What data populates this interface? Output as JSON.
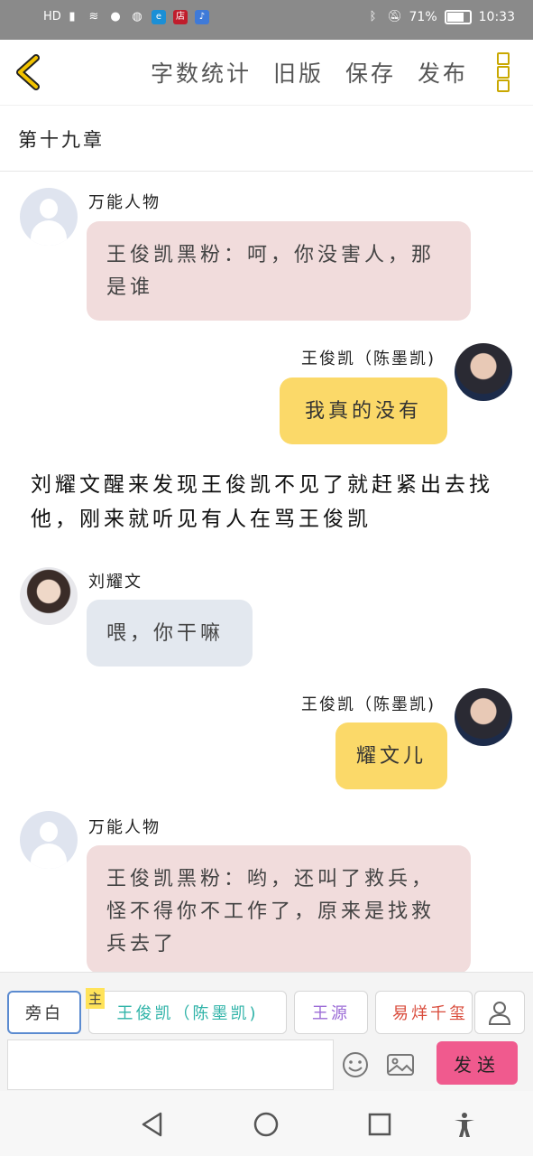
{
  "status_bar": {
    "left_icons": [
      "hd-icon",
      "signal-icon",
      "wifi-icon",
      "qq-icon",
      "wechat-icon",
      "browser-icon",
      "store-icon",
      "music-icon"
    ],
    "store_label": "店",
    "right_icons": [
      "bluetooth-icon",
      "mute-icon"
    ],
    "battery": "71%",
    "time": "10:33"
  },
  "toolbar": {
    "word_count": "字数统计",
    "old_version": "旧版",
    "save": "保存",
    "publish": "发布"
  },
  "chapter_title": "第十九章",
  "messages": [
    {
      "sender": "万能人物",
      "text": "王俊凯黑粉：呵，你没害人，那是谁"
    },
    {
      "sender": "王俊凯（陈墨凯)",
      "text": "我真的没有"
    },
    {
      "narration": "刘耀文醒来发现王俊凯不见了就赶紧出去找他，刚来就听见有人在骂王俊凯"
    },
    {
      "sender": "刘耀文",
      "text": "喂，你干嘛"
    },
    {
      "sender": "王俊凯（陈墨凯)",
      "text": "耀文儿"
    },
    {
      "sender": "万能人物",
      "text": "王俊凯黑粉：哟，还叫了救兵，怪不得你不工作了，原来是找救兵去了"
    }
  ],
  "roles": {
    "narration": "旁白",
    "main_tag": "主",
    "main": "王俊凯（陈墨凯)",
    "wang_yuan": "王源",
    "yi_yangqianxi": "易烊千玺"
  },
  "input": {
    "value": "",
    "send_label": "发送"
  },
  "colors": {
    "pink_bubble": "#f1dcdc",
    "yellow_bubble": "#fbd969",
    "grey_bubble": "#e3e8ef",
    "send_button": "#f05a8e",
    "accent_gold": "#c9a800"
  }
}
